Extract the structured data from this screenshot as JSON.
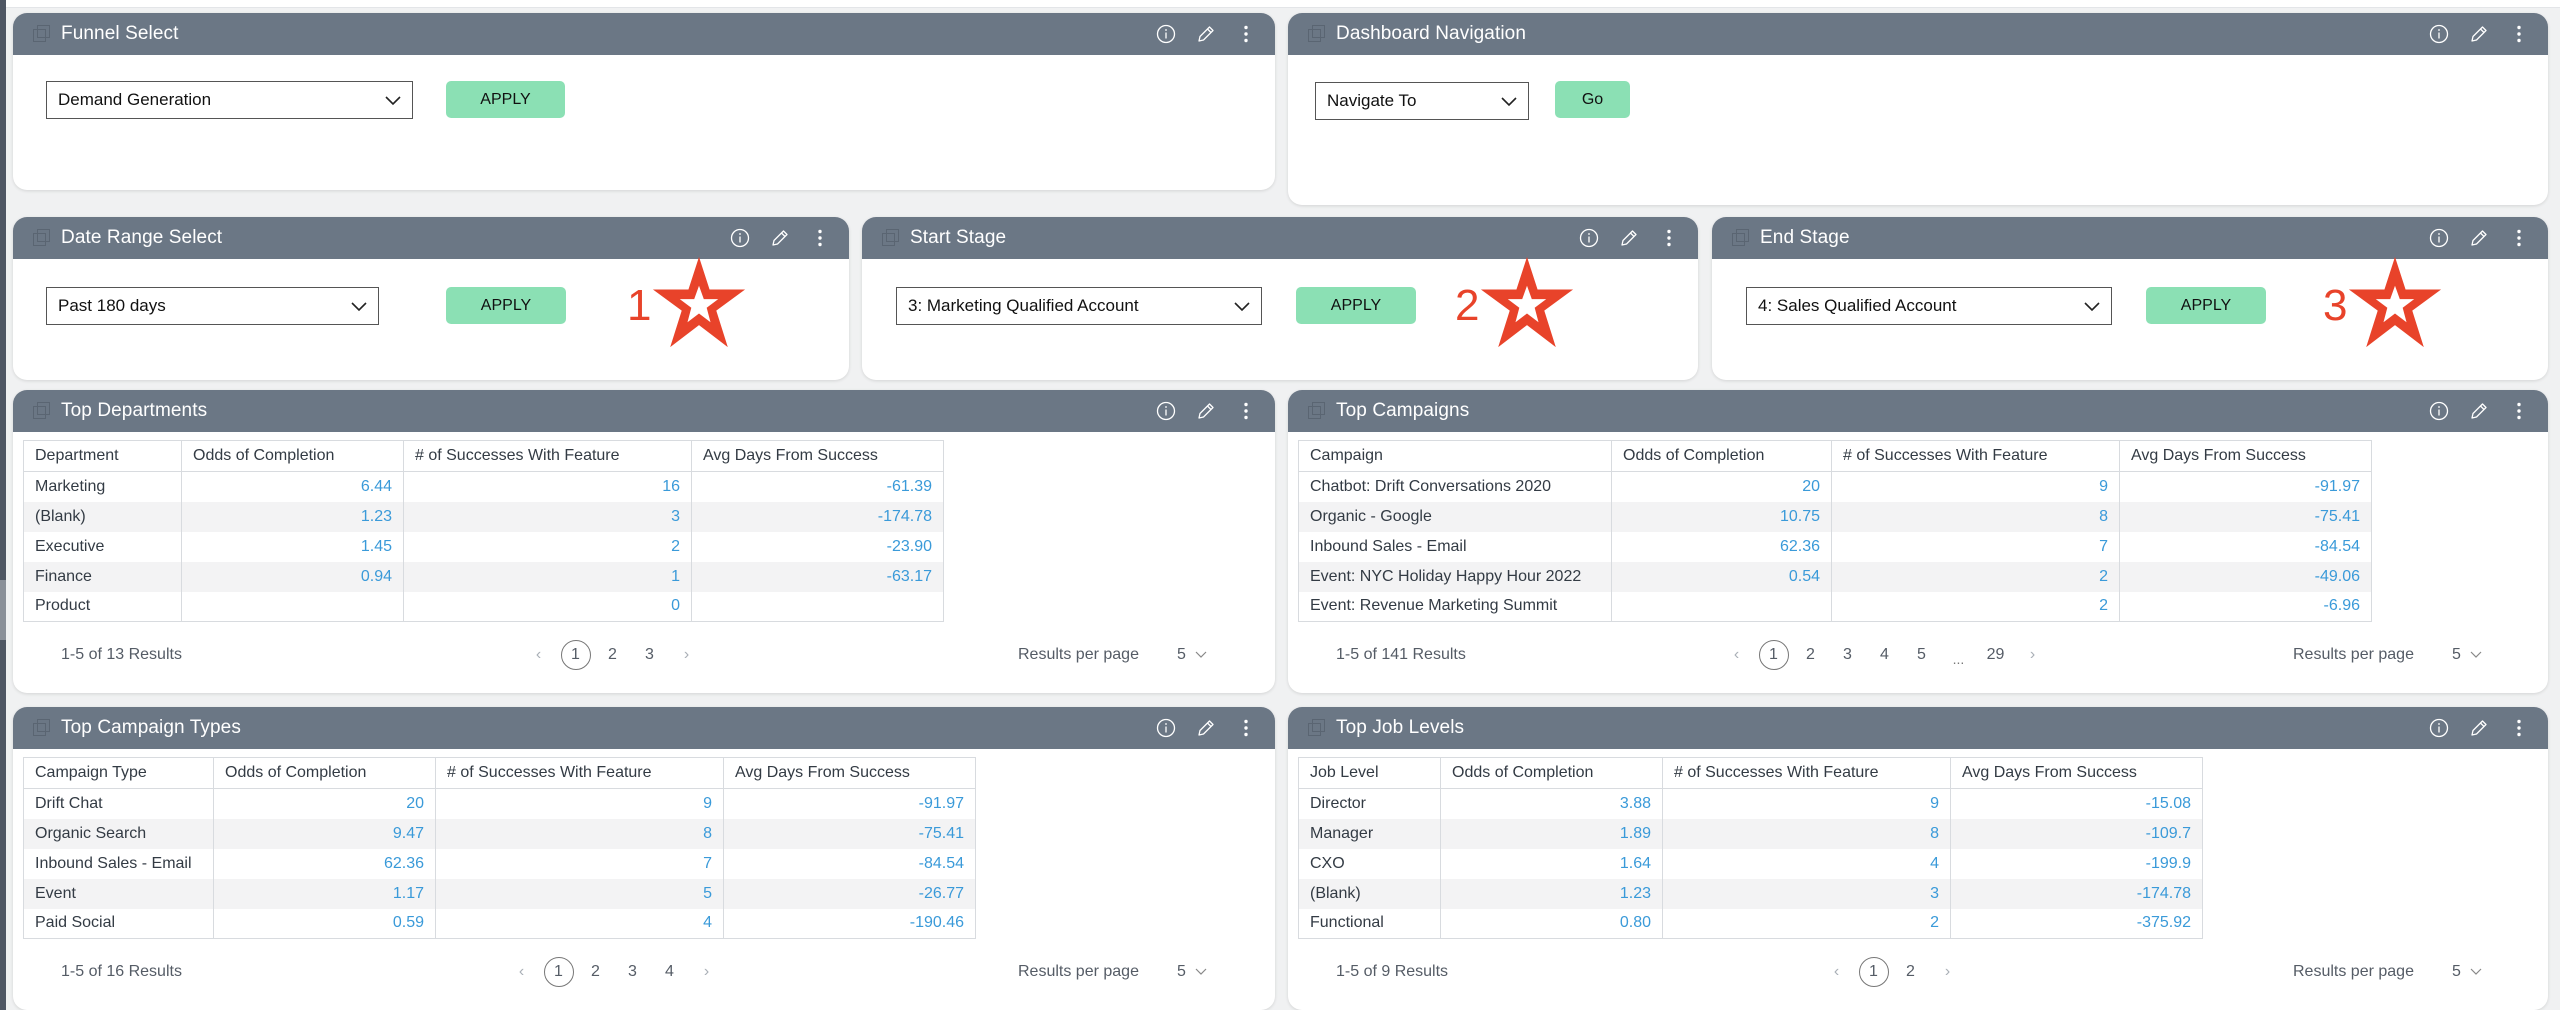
{
  "colors": {
    "header_bg": "#6b7785",
    "apply_button": "#8be0b4",
    "link_blue": "#3a9ad9",
    "annotation_red": "#e8432a"
  },
  "header_actions": {
    "info_icon": "info-icon",
    "edit_icon": "pencil-icon",
    "menu_icon": "kebab-menu-icon"
  },
  "funnel_select": {
    "title": "Funnel Select",
    "select_value": "Demand Generation",
    "button": "APPLY"
  },
  "dashboard_navigation": {
    "title": "Dashboard Navigation",
    "select_value": "Navigate To",
    "button": "Go"
  },
  "date_range_select": {
    "title": "Date Range Select",
    "select_value": "Past 180 days",
    "button": "APPLY",
    "annotation": "1"
  },
  "start_stage": {
    "title": "Start Stage",
    "select_value": "3: Marketing Qualified Account",
    "button": "APPLY",
    "annotation": "2"
  },
  "end_stage": {
    "title": "End Stage",
    "select_value": "4: Sales Qualified Account",
    "button": "APPLY",
    "annotation": "3"
  },
  "top_departments": {
    "title": "Top Departments",
    "columns": [
      "Department",
      "Odds of Completion",
      "# of Successes With Feature",
      "Avg Days From Success"
    ],
    "rows": [
      [
        "Marketing",
        "6.44",
        "16",
        "-61.39"
      ],
      [
        "(Blank)",
        "1.23",
        "3",
        "-174.78"
      ],
      [
        "Executive",
        "1.45",
        "2",
        "-23.90"
      ],
      [
        "Finance",
        "0.94",
        "1",
        "-63.17"
      ],
      [
        "Product",
        "",
        "0",
        ""
      ]
    ],
    "result_count": "1-5 of 13 Results",
    "pages": [
      "1",
      "2",
      "3"
    ],
    "current_page": "1",
    "results_per_page_label": "Results per page",
    "results_per_page": "5"
  },
  "top_campaigns": {
    "title": "Top Campaigns",
    "columns": [
      "Campaign",
      "Odds of Completion",
      "# of Successes With Feature",
      "Avg Days From Success"
    ],
    "rows": [
      [
        "Chatbot: Drift Conversations 2020",
        "20",
        "9",
        "-91.97"
      ],
      [
        "Organic - Google",
        "10.75",
        "8",
        "-75.41"
      ],
      [
        "Inbound Sales - Email",
        "62.36",
        "7",
        "-84.54"
      ],
      [
        "Event: NYC Holiday Happy Hour 2022",
        "0.54",
        "2",
        "-49.06"
      ],
      [
        "Event: Revenue Marketing Summit",
        "",
        "2",
        "-6.96"
      ]
    ],
    "result_count": "1-5 of 141 Results",
    "pages": [
      "1",
      "2",
      "3",
      "4",
      "5"
    ],
    "ellipsis": "...",
    "last_page": "29",
    "current_page": "1",
    "results_per_page_label": "Results per page",
    "results_per_page": "5"
  },
  "top_campaign_types": {
    "title": "Top Campaign Types",
    "columns": [
      "Campaign Type",
      "Odds of Completion",
      "# of Successes With Feature",
      "Avg Days From Success"
    ],
    "rows": [
      [
        "Drift Chat",
        "20",
        "9",
        "-91.97"
      ],
      [
        "Organic Search",
        "9.47",
        "8",
        "-75.41"
      ],
      [
        "Inbound Sales - Email",
        "62.36",
        "7",
        "-84.54"
      ],
      [
        "Event",
        "1.17",
        "5",
        "-26.77"
      ],
      [
        "Paid Social",
        "0.59",
        "4",
        "-190.46"
      ]
    ],
    "result_count": "1-5 of 16 Results",
    "pages": [
      "1",
      "2",
      "3",
      "4"
    ],
    "current_page": "1",
    "results_per_page_label": "Results per page",
    "results_per_page": "5"
  },
  "top_job_levels": {
    "title": "Top Job Levels",
    "columns": [
      "Job Level",
      "Odds of Completion",
      "# of Successes With Feature",
      "Avg Days From Success"
    ],
    "rows": [
      [
        "Director",
        "3.88",
        "9",
        "-15.08"
      ],
      [
        "Manager",
        "1.89",
        "8",
        "-109.7"
      ],
      [
        "CXO",
        "1.64",
        "4",
        "-199.9"
      ],
      [
        "(Blank)",
        "1.23",
        "3",
        "-174.78"
      ],
      [
        "Functional",
        "0.80",
        "2",
        "-375.92"
      ]
    ],
    "result_count": "1-5 of 9 Results",
    "pages": [
      "1",
      "2"
    ],
    "current_page": "1",
    "results_per_page_label": "Results per page",
    "results_per_page": "5"
  }
}
